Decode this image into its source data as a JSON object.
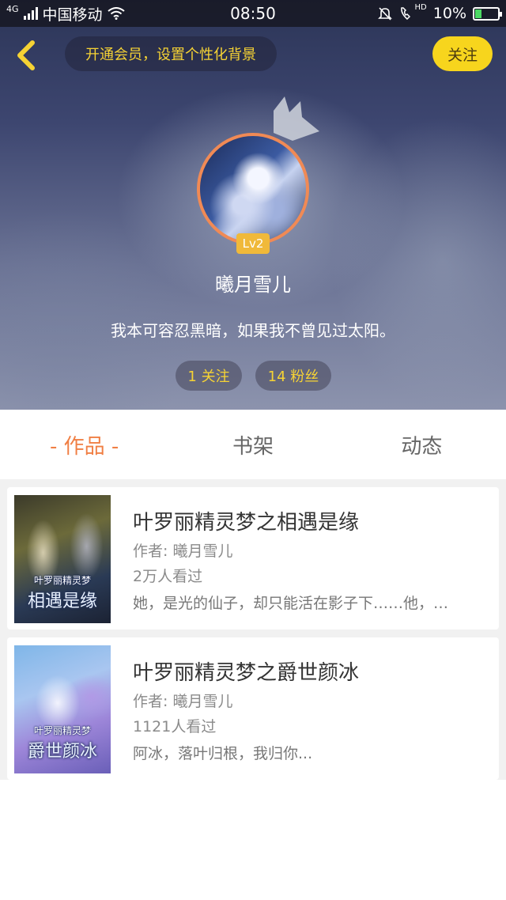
{
  "status_bar": {
    "network": "4G",
    "carrier": "中国移动",
    "time": "08:50",
    "hd": "HD",
    "battery": "10%"
  },
  "header": {
    "promo": "开通会员，设置个性化背景",
    "follow_label": "关注"
  },
  "profile": {
    "level": "Lv2",
    "nickname": "曦月雪儿",
    "signature": "我本可容忍黑暗，如果我不曾见过太阳。",
    "following": "1 关注",
    "fans": "14 粉丝"
  },
  "tabs": [
    {
      "label": "- 作品 -",
      "active": true
    },
    {
      "label": "书架",
      "active": false
    },
    {
      "label": "动态",
      "active": false
    }
  ],
  "books": [
    {
      "title": "叶罗丽精灵梦之相遇是缘",
      "author": "作者: 曦月雪儿",
      "views": "2万人看过",
      "desc": "她，是光的仙子，却只能活在影子下……他，…",
      "cover_series": "叶罗丽精灵梦",
      "cover_title": "相遇是缘"
    },
    {
      "title": "叶罗丽精灵梦之爵世颜冰",
      "author": "作者: 曦月雪儿",
      "views": "1121人看过",
      "desc": "阿冰，落叶归根，我归你...",
      "cover_series": "叶罗丽精灵梦",
      "cover_title": "爵世颜冰"
    }
  ],
  "colors": {
    "accent": "#f07f44",
    "follow_button": "#f7d51d",
    "promo_text": "#f6d334",
    "level_badge": "#f0b93a"
  },
  "icons": {
    "back": "chevron-left-icon",
    "crown": "crown-icon",
    "wifi": "wifi-icon",
    "mute": "bell-off-icon",
    "call": "phone-hd-icon",
    "battery": "battery-charging-icon"
  }
}
